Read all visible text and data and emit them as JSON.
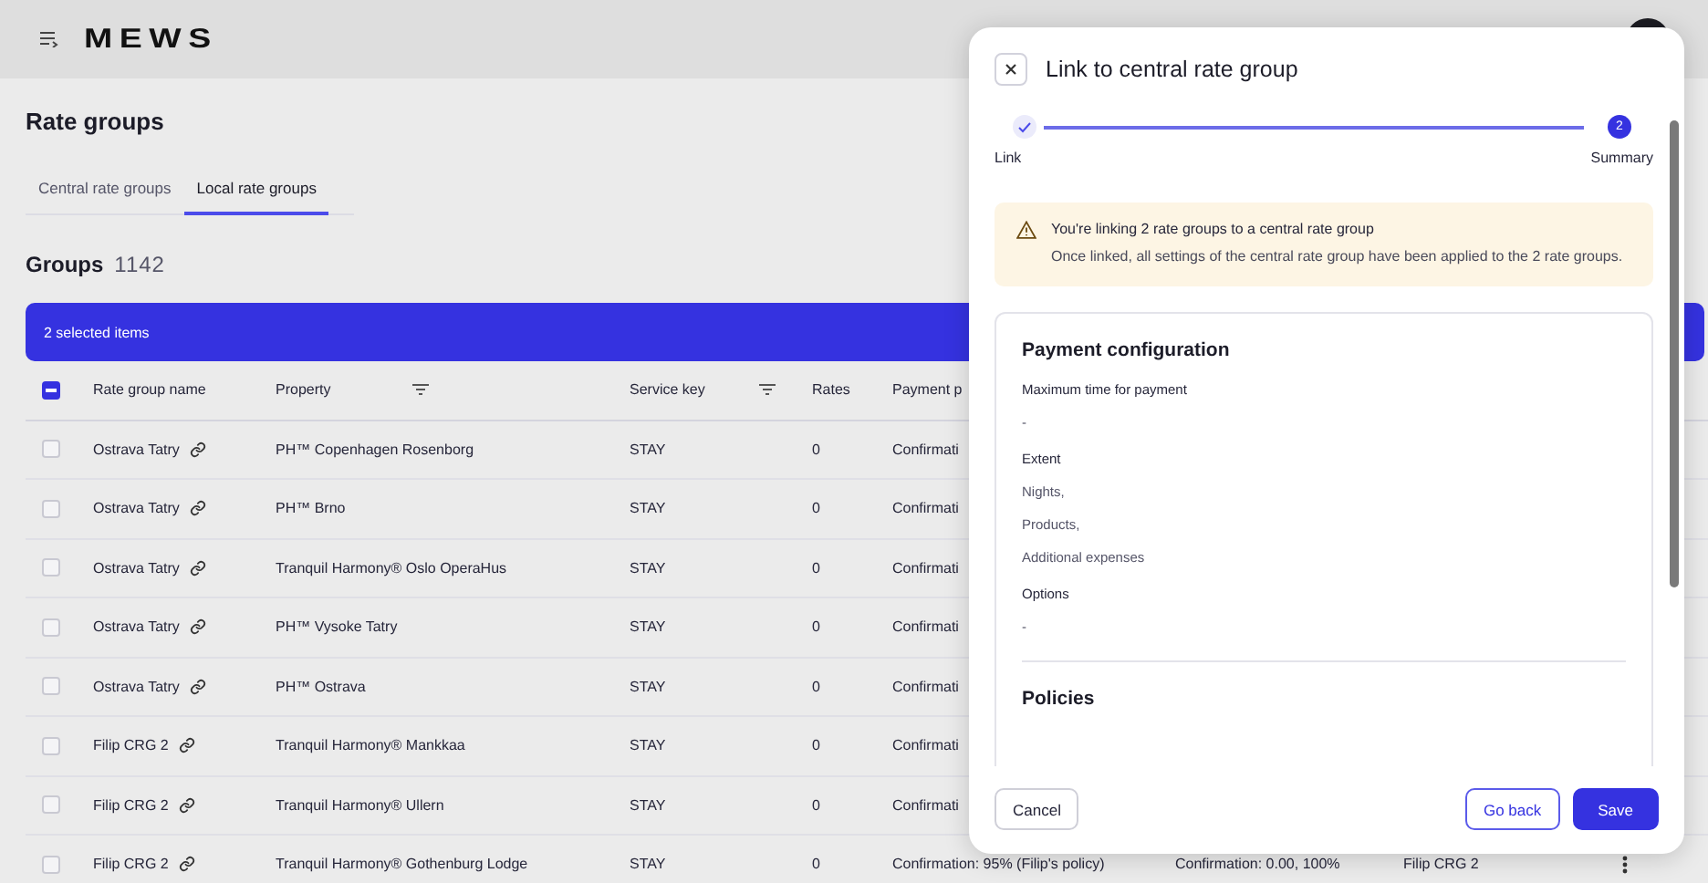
{
  "top_bar": {
    "logo": "MEWS"
  },
  "page": {
    "title": "Rate groups"
  },
  "tabs": [
    {
      "label": "Central rate groups",
      "selected": false
    },
    {
      "label": "Local rate groups",
      "selected": true
    }
  ],
  "groups": {
    "title": "Groups",
    "count": "1142"
  },
  "selection_bar": {
    "text": "2 selected items"
  },
  "table": {
    "header_checkbox": {
      "indeterminate": true
    },
    "columns": [
      {
        "label": "Rate group name",
        "filter": false
      },
      {
        "label": "Property",
        "filter": true
      },
      {
        "label": "Service key",
        "filter": true
      },
      {
        "label": "Rates",
        "filter": false
      },
      {
        "label": "Payment p",
        "filter": false
      }
    ],
    "rows": [
      {
        "selected": false,
        "name": "Ostrava Tatry",
        "linked": true,
        "property": "PH™ Copenhagen Rosenborg",
        "service_key": "STAY",
        "rates": "0",
        "payment": "Confirmati"
      },
      {
        "selected": false,
        "name": "Ostrava Tatry",
        "linked": true,
        "property": "PH™ Brno",
        "service_key": "STAY",
        "rates": "0",
        "payment": "Confirmati"
      },
      {
        "selected": false,
        "name": "Ostrava Tatry",
        "linked": true,
        "property": "Tranquil Harmony® Oslo OperaHus",
        "service_key": "STAY",
        "rates": "0",
        "payment": "Confirmati"
      },
      {
        "selected": false,
        "name": "Ostrava Tatry",
        "linked": true,
        "property": "PH™ Vysoke Tatry",
        "service_key": "STAY",
        "rates": "0",
        "payment": "Confirmati"
      },
      {
        "selected": false,
        "name": "Ostrava Tatry",
        "linked": true,
        "property": "PH™ Ostrava",
        "service_key": "STAY",
        "rates": "0",
        "payment": "Confirmati"
      },
      {
        "selected": false,
        "name": "Filip CRG 2",
        "linked": true,
        "property": "Tranquil Harmony® Mankkaa",
        "service_key": "STAY",
        "rates": "0",
        "payment": "Confirmati"
      },
      {
        "selected": false,
        "name": "Filip CRG 2",
        "linked": true,
        "property": "Tranquil Harmony® Ullern",
        "service_key": "STAY",
        "rates": "0",
        "payment": "Confirmati"
      },
      {
        "selected": false,
        "name": "Filip CRG 2",
        "linked": true,
        "property": "Tranquil Harmony® Gothenburg Lodge",
        "service_key": "STAY",
        "rates": "0",
        "payment": "Confirmation: 95% (Filip's policy)",
        "column_6": "Confirmation: 0.00, 100%",
        "column_7": "Filip CRG 2",
        "has_menu": true
      }
    ]
  },
  "dialog": {
    "title": "Link to central rate group",
    "steps": [
      {
        "label": "Link",
        "done": true
      },
      {
        "label": "Summary",
        "number": "2",
        "done": false
      }
    ],
    "warning": {
      "title": "You're linking 2 rate groups to a central rate group",
      "text": "Once linked, all settings of the central rate group have been applied to the 2 rate groups."
    },
    "sections": [
      {
        "title": "Payment configuration",
        "fields": [
          {
            "label": "Maximum time for payment",
            "values": [
              "-"
            ]
          },
          {
            "label": "Extent",
            "values": [
              "Nights,",
              "Products,",
              "Additional expenses"
            ]
          },
          {
            "label": "Options",
            "values": [
              "-"
            ]
          }
        ]
      },
      {
        "title": "Policies"
      }
    ],
    "buttons": [
      {
        "label": "Cancel",
        "kind": "secondary"
      },
      {
        "label": "Go back",
        "kind": "outline"
      },
      {
        "label": "Save",
        "kind": "primary"
      }
    ]
  }
}
